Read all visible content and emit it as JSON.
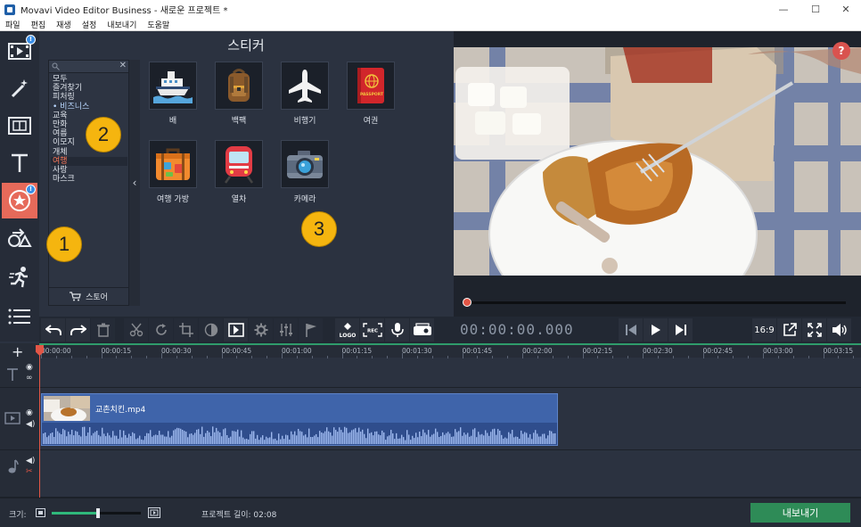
{
  "window": {
    "title": "Movavi Video Editor Business - 새로운 프로젝트 *",
    "minimize": "—",
    "maximize": "☐",
    "close": "✕"
  },
  "menu": [
    "파일",
    "편집",
    "재생",
    "설정",
    "내보내기",
    "도움말"
  ],
  "toolrail": {
    "badges": [
      "!",
      "!"
    ]
  },
  "stickers_panel": {
    "title": "스티커",
    "categories": [
      "모두",
      "즐겨찾기",
      "피처링",
      "• 비즈니스",
      "교육",
      "만화",
      "여름",
      "이모지",
      "개체",
      "여행",
      "사랑",
      "마스크"
    ],
    "selected_category": "여행",
    "store_label": "스토어",
    "items": [
      "배",
      "백팩",
      "비행기",
      "여권",
      "여행 가방",
      "열차",
      "카메라"
    ],
    "passport_text": "PASSPORT"
  },
  "callouts": [
    "1",
    "2",
    "3"
  ],
  "preview": {
    "help": "?",
    "timecode": "00:00:00.000",
    "aspect": "16:9"
  },
  "timeline": {
    "ticks": [
      "00:00:00",
      "00:00:15",
      "00:00:30",
      "00:00:45",
      "00:01:00",
      "00:01:15",
      "00:01:30",
      "00:01:45",
      "00:02:00",
      "00:02:15",
      "00:02:30",
      "00:02:45",
      "00:03:00",
      "00:03:15"
    ],
    "clip_name": "교촌치킨.mp4"
  },
  "status": {
    "zoom_label": "크기:",
    "zoom_value": 0.52,
    "project_length": "프로젝트 길이:  02:08",
    "export_label": "내보내기"
  },
  "colors": {
    "accent": "#e66a5a",
    "export": "#2e8b57",
    "clip": "#3f64aa",
    "callout": "#f5b50f"
  }
}
